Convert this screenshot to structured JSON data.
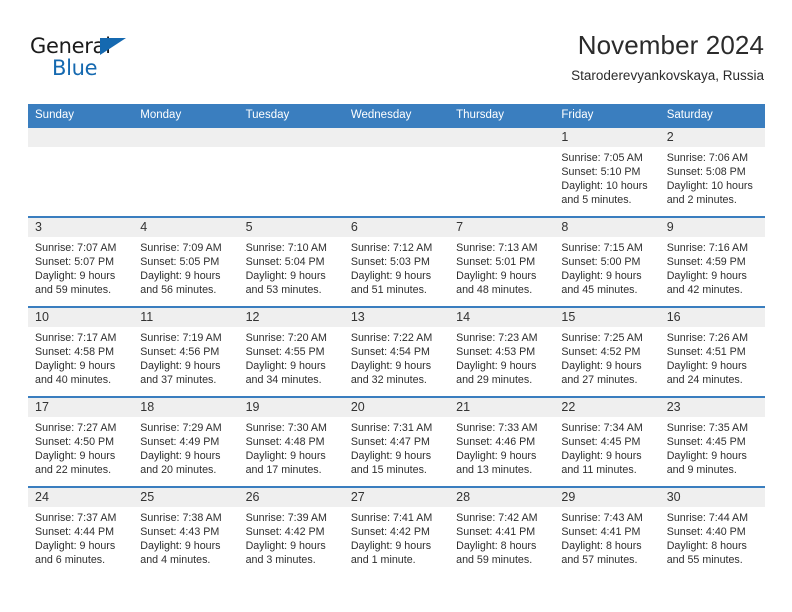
{
  "brand": {
    "name_part1": "General",
    "name_part2": "Blue",
    "accent_color": "#1569b0"
  },
  "header": {
    "title": "November 2024",
    "subtitle": "Staroderevyankovskaya, Russia"
  },
  "theme": {
    "header_row_bg": "#3a7ebf",
    "daynum_band_bg": "#efefef",
    "cell_border": "#3a7ebf"
  },
  "weekdays": [
    "Sunday",
    "Monday",
    "Tuesday",
    "Wednesday",
    "Thursday",
    "Friday",
    "Saturday"
  ],
  "weeks": [
    [
      {
        "day": "",
        "lines": []
      },
      {
        "day": "",
        "lines": []
      },
      {
        "day": "",
        "lines": []
      },
      {
        "day": "",
        "lines": []
      },
      {
        "day": "",
        "lines": []
      },
      {
        "day": "1",
        "lines": [
          "Sunrise: 7:05 AM",
          "Sunset: 5:10 PM",
          "Daylight: 10 hours",
          "and 5 minutes."
        ]
      },
      {
        "day": "2",
        "lines": [
          "Sunrise: 7:06 AM",
          "Sunset: 5:08 PM",
          "Daylight: 10 hours",
          "and 2 minutes."
        ]
      }
    ],
    [
      {
        "day": "3",
        "lines": [
          "Sunrise: 7:07 AM",
          "Sunset: 5:07 PM",
          "Daylight: 9 hours",
          "and 59 minutes."
        ]
      },
      {
        "day": "4",
        "lines": [
          "Sunrise: 7:09 AM",
          "Sunset: 5:05 PM",
          "Daylight: 9 hours",
          "and 56 minutes."
        ]
      },
      {
        "day": "5",
        "lines": [
          "Sunrise: 7:10 AM",
          "Sunset: 5:04 PM",
          "Daylight: 9 hours",
          "and 53 minutes."
        ]
      },
      {
        "day": "6",
        "lines": [
          "Sunrise: 7:12 AM",
          "Sunset: 5:03 PM",
          "Daylight: 9 hours",
          "and 51 minutes."
        ]
      },
      {
        "day": "7",
        "lines": [
          "Sunrise: 7:13 AM",
          "Sunset: 5:01 PM",
          "Daylight: 9 hours",
          "and 48 minutes."
        ]
      },
      {
        "day": "8",
        "lines": [
          "Sunrise: 7:15 AM",
          "Sunset: 5:00 PM",
          "Daylight: 9 hours",
          "and 45 minutes."
        ]
      },
      {
        "day": "9",
        "lines": [
          "Sunrise: 7:16 AM",
          "Sunset: 4:59 PM",
          "Daylight: 9 hours",
          "and 42 minutes."
        ]
      }
    ],
    [
      {
        "day": "10",
        "lines": [
          "Sunrise: 7:17 AM",
          "Sunset: 4:58 PM",
          "Daylight: 9 hours",
          "and 40 minutes."
        ]
      },
      {
        "day": "11",
        "lines": [
          "Sunrise: 7:19 AM",
          "Sunset: 4:56 PM",
          "Daylight: 9 hours",
          "and 37 minutes."
        ]
      },
      {
        "day": "12",
        "lines": [
          "Sunrise: 7:20 AM",
          "Sunset: 4:55 PM",
          "Daylight: 9 hours",
          "and 34 minutes."
        ]
      },
      {
        "day": "13",
        "lines": [
          "Sunrise: 7:22 AM",
          "Sunset: 4:54 PM",
          "Daylight: 9 hours",
          "and 32 minutes."
        ]
      },
      {
        "day": "14",
        "lines": [
          "Sunrise: 7:23 AM",
          "Sunset: 4:53 PM",
          "Daylight: 9 hours",
          "and 29 minutes."
        ]
      },
      {
        "day": "15",
        "lines": [
          "Sunrise: 7:25 AM",
          "Sunset: 4:52 PM",
          "Daylight: 9 hours",
          "and 27 minutes."
        ]
      },
      {
        "day": "16",
        "lines": [
          "Sunrise: 7:26 AM",
          "Sunset: 4:51 PM",
          "Daylight: 9 hours",
          "and 24 minutes."
        ]
      }
    ],
    [
      {
        "day": "17",
        "lines": [
          "Sunrise: 7:27 AM",
          "Sunset: 4:50 PM",
          "Daylight: 9 hours",
          "and 22 minutes."
        ]
      },
      {
        "day": "18",
        "lines": [
          "Sunrise: 7:29 AM",
          "Sunset: 4:49 PM",
          "Daylight: 9 hours",
          "and 20 minutes."
        ]
      },
      {
        "day": "19",
        "lines": [
          "Sunrise: 7:30 AM",
          "Sunset: 4:48 PM",
          "Daylight: 9 hours",
          "and 17 minutes."
        ]
      },
      {
        "day": "20",
        "lines": [
          "Sunrise: 7:31 AM",
          "Sunset: 4:47 PM",
          "Daylight: 9 hours",
          "and 15 minutes."
        ]
      },
      {
        "day": "21",
        "lines": [
          "Sunrise: 7:33 AM",
          "Sunset: 4:46 PM",
          "Daylight: 9 hours",
          "and 13 minutes."
        ]
      },
      {
        "day": "22",
        "lines": [
          "Sunrise: 7:34 AM",
          "Sunset: 4:45 PM",
          "Daylight: 9 hours",
          "and 11 minutes."
        ]
      },
      {
        "day": "23",
        "lines": [
          "Sunrise: 7:35 AM",
          "Sunset: 4:45 PM",
          "Daylight: 9 hours",
          "and 9 minutes."
        ]
      }
    ],
    [
      {
        "day": "24",
        "lines": [
          "Sunrise: 7:37 AM",
          "Sunset: 4:44 PM",
          "Daylight: 9 hours",
          "and 6 minutes."
        ]
      },
      {
        "day": "25",
        "lines": [
          "Sunrise: 7:38 AM",
          "Sunset: 4:43 PM",
          "Daylight: 9 hours",
          "and 4 minutes."
        ]
      },
      {
        "day": "26",
        "lines": [
          "Sunrise: 7:39 AM",
          "Sunset: 4:42 PM",
          "Daylight: 9 hours",
          "and 3 minutes."
        ]
      },
      {
        "day": "27",
        "lines": [
          "Sunrise: 7:41 AM",
          "Sunset: 4:42 PM",
          "Daylight: 9 hours",
          "and 1 minute."
        ]
      },
      {
        "day": "28",
        "lines": [
          "Sunrise: 7:42 AM",
          "Sunset: 4:41 PM",
          "Daylight: 8 hours",
          "and 59 minutes."
        ]
      },
      {
        "day": "29",
        "lines": [
          "Sunrise: 7:43 AM",
          "Sunset: 4:41 PM",
          "Daylight: 8 hours",
          "and 57 minutes."
        ]
      },
      {
        "day": "30",
        "lines": [
          "Sunrise: 7:44 AM",
          "Sunset: 4:40 PM",
          "Daylight: 8 hours",
          "and 55 minutes."
        ]
      }
    ]
  ]
}
